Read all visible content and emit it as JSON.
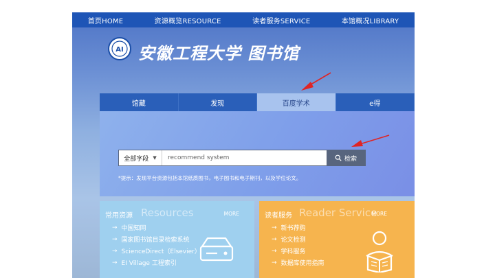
{
  "topnav": {
    "items": [
      "首页HOME",
      "资源概览RESOURCE",
      "读者服务SERVICE",
      "本馆概况LIBRARY"
    ]
  },
  "header": {
    "title": "安徽工程大学 图书馆",
    "logo_icon": "university-emblem-icon"
  },
  "search": {
    "tabs": [
      {
        "label": "馆藏",
        "active": false
      },
      {
        "label": "发现",
        "active": false
      },
      {
        "label": "百度学术",
        "active": true
      },
      {
        "label": "e得",
        "active": false
      }
    ],
    "scope_value": "全部字段",
    "query": "recommend system",
    "button_label": "检索",
    "hint": "*提示：发现平台资源包括本馆纸质图书，电子图书和电子期刊，以及学位论文。"
  },
  "resources_card": {
    "title_cn": "常用资源",
    "title_en": "Resources",
    "more": "MORE",
    "items": [
      "中国知网",
      "国家图书馆目录检索系统",
      "ScienceDirect（Elsevier）",
      "EI Village 工程索引"
    ]
  },
  "service_card": {
    "title_cn": "读者服务",
    "title_en": "Reader Service",
    "more": "MORE",
    "items": [
      "新书荐购",
      "论文检测",
      "学科服务",
      "数据库使用指南"
    ]
  },
  "colors": {
    "nav": "#1e55b6",
    "panel": "#7f9fea",
    "search_button": "#58657e",
    "resources": "#9fd0ef",
    "service": "#f6b44e",
    "annotation": "#e02424"
  }
}
